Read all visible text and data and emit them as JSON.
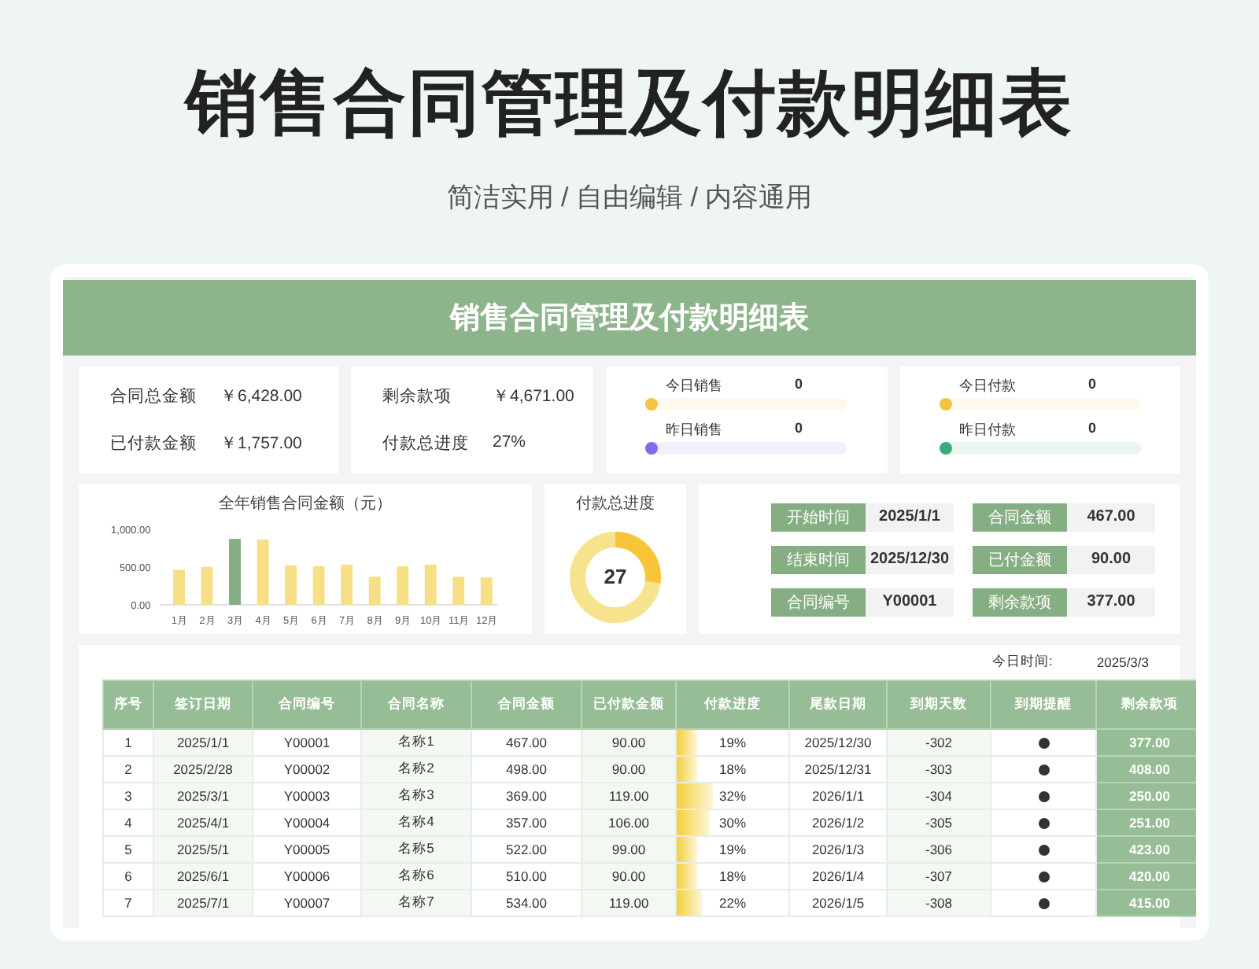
{
  "page_title": "销售合同管理及付款明细表",
  "subtitle": "简洁实用 / 自由编辑 / 内容通用",
  "sheet_title": "销售合同管理及付款明细表",
  "summary_cards": [
    {
      "items": [
        {
          "label": "合同总金额",
          "value": "￥6,428.00"
        },
        {
          "label": "已付款金额",
          "value": "￥1,757.00"
        }
      ]
    },
    {
      "items": [
        {
          "label": "剩余款项",
          "value": "￥4,671.00"
        },
        {
          "label": "付款总进度",
          "value": "27%"
        }
      ]
    }
  ],
  "daily_cards": [
    {
      "items": [
        {
          "label": "今日销售",
          "value": "0",
          "color": "#f5c342"
        },
        {
          "label": "昨日销售",
          "value": "0",
          "color": "#7b6cf0"
        }
      ]
    },
    {
      "items": [
        {
          "label": "今日付款",
          "value": "0",
          "color": "#f5c342"
        },
        {
          "label": "昨日付款",
          "value": "0",
          "color": "#3daa7a"
        }
      ]
    }
  ],
  "sales_chart": {
    "chart_data": {
      "type": "bar",
      "title": "全年销售合同金额（元）",
      "categories": [
        "1月",
        "2月",
        "3月",
        "4月",
        "5月",
        "6月",
        "7月",
        "8月",
        "9月",
        "10月",
        "11月",
        "12月"
      ],
      "stacked": true,
      "series": [
        {
          "color": "#f6df85",
          "values": [
            460,
            500,
            null,
            860,
            520,
            510,
            530,
            370,
            510,
            530,
            370,
            360
          ]
        },
        {
          "color": "#86ae83",
          "values": [
            null,
            null,
            870,
            null,
            null,
            null,
            null,
            null,
            null,
            null,
            null,
            null
          ]
        }
      ],
      "ylim": [
        0,
        1000
      ],
      "yticks": [
        {
          "value": 0,
          "label": "0.00"
        },
        {
          "value": 500,
          "label": "500.00"
        },
        {
          "value": 1000,
          "label": "1,000.00"
        }
      ]
    }
  },
  "progress_donut": {
    "title": "付款总进度",
    "level": 0.27,
    "value": "27"
  },
  "detail_panel": [
    {
      "label": "开始时间",
      "value": "2025/1/1"
    },
    {
      "label": "合同金额",
      "value": "467.00"
    },
    {
      "label": "结束时间",
      "value": "2025/12/30"
    },
    {
      "label": "已付金额",
      "value": "90.00"
    },
    {
      "label": "合同编号",
      "value": "Y00001"
    },
    {
      "label": "剩余款项",
      "value": "377.00"
    }
  ],
  "today": {
    "label": "今日时间:",
    "value": "2025/3/3"
  },
  "table": {
    "columns": [
      "序号",
      "签订日期",
      "合同编号",
      "合同名称",
      "合同金额",
      "已付款金额",
      "付款进度",
      "尾款日期",
      "到期天数",
      "到期提醒",
      "剩余款项"
    ],
    "rows": [
      {
        "cells": [
          "1",
          "2025/1/1",
          "Y00001",
          "名称1",
          "467.00",
          "90.00"
        ],
        "progress": "19%",
        "level": 0.19,
        "due": "2025/12/30",
        "days": "-302",
        "reminder": true,
        "remaining": "377.00"
      },
      {
        "cells": [
          "2",
          "2025/2/28",
          "Y00002",
          "名称2",
          "498.00",
          "90.00"
        ],
        "progress": "18%",
        "level": 0.18,
        "due": "2025/12/31",
        "days": "-303",
        "reminder": true,
        "remaining": "408.00"
      },
      {
        "cells": [
          "3",
          "2025/3/1",
          "Y00003",
          "名称3",
          "369.00",
          "119.00"
        ],
        "progress": "32%",
        "level": 0.32,
        "due": "2026/1/1",
        "days": "-304",
        "reminder": true,
        "remaining": "250.00"
      },
      {
        "cells": [
          "4",
          "2025/4/1",
          "Y00004",
          "名称4",
          "357.00",
          "106.00"
        ],
        "progress": "30%",
        "level": 0.3,
        "due": "2026/1/2",
        "days": "-305",
        "reminder": true,
        "remaining": "251.00"
      },
      {
        "cells": [
          "5",
          "2025/5/1",
          "Y00005",
          "名称5",
          "522.00",
          "99.00"
        ],
        "progress": "19%",
        "level": 0.19,
        "due": "2026/1/3",
        "days": "-306",
        "reminder": true,
        "remaining": "423.00"
      },
      {
        "cells": [
          "6",
          "2025/6/1",
          "Y00006",
          "名称6",
          "510.00",
          "90.00"
        ],
        "progress": "18%",
        "level": 0.18,
        "due": "2026/1/4",
        "days": "-307",
        "reminder": true,
        "remaining": "420.00"
      },
      {
        "cells": [
          "7",
          "2025/7/1",
          "Y00007",
          "名称7",
          "534.00",
          "119.00"
        ],
        "progress": "22%",
        "level": 0.22,
        "due": "2026/1/5",
        "days": "-308",
        "reminder": true,
        "remaining": "415.00"
      }
    ]
  }
}
